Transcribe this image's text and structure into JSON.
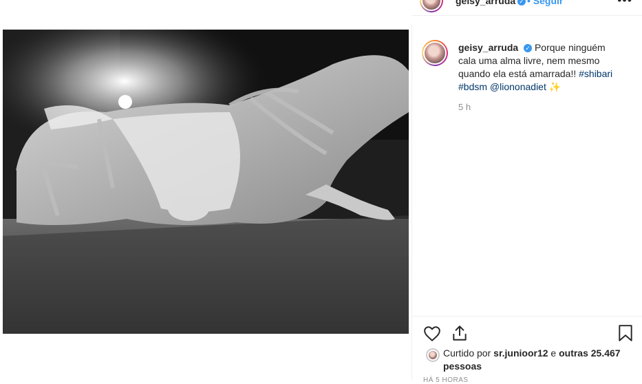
{
  "header": {
    "username": "geisy_arruda",
    "follow_label": "Seguir",
    "more_label": "•••"
  },
  "caption": {
    "username": "geisy_arruda",
    "text": "Porque ninguém cala uma alma livre, nem mesmo quando ela está amarrada!!",
    "hashtags": [
      "#shibari",
      "#bdsm"
    ],
    "mention": "@liononadiet",
    "emoji": "✨",
    "time_ago": "5 h"
  },
  "likes": {
    "prefix": "Curtido por",
    "user": "sr.junioor12",
    "connector": "e",
    "others": "outras 25.467 pessoas"
  },
  "timestamp": "HÁ 5 HORAS",
  "icons": {
    "like": "heart-icon",
    "share": "share-icon",
    "save": "bookmark-icon",
    "verified": "verified-badge-icon"
  },
  "colors": {
    "accent_blue": "#3897f0",
    "hashtag": "#00376b",
    "secondary_text": "#8e8e8e"
  }
}
